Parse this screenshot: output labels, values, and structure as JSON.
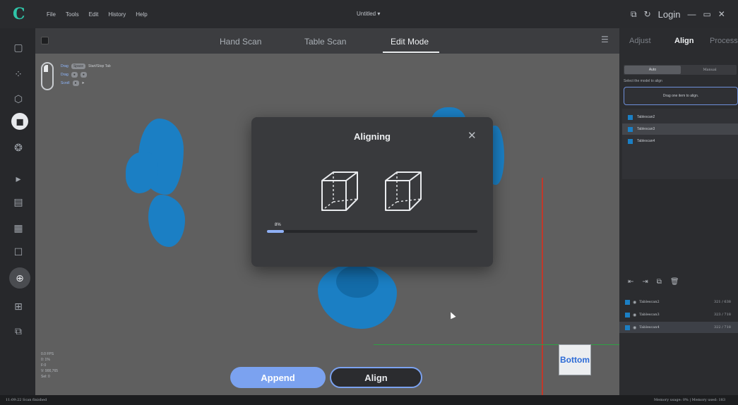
{
  "menu": [
    "File",
    "Tools",
    "Edit",
    "History",
    "Help"
  ],
  "document_title": "Untitled",
  "login_label": "Login",
  "colors": {
    "accent": "#7ba2f0",
    "scan_blue": "#1b7fc4",
    "logo_green": "#2fc4a8"
  },
  "modes": [
    "Hand Scan",
    "Table Scan",
    "Edit Mode"
  ],
  "active_mode": "Edit Mode",
  "mouse_hints": [
    {
      "key": "Drag",
      "chip": "Space",
      "text": "Start/Stop Tab"
    },
    {
      "key": "Drag",
      "chip": "",
      "text": ""
    },
    {
      "key": "Scroll",
      "chip": "",
      "text": ""
    }
  ],
  "viewport": {
    "stats": [
      "0.0 FPS",
      "0: 1%",
      "F:0",
      "V: 900,765",
      "Sel: 0"
    ],
    "viewcube_label": "Bottom"
  },
  "dialog": {
    "title": "Aligning",
    "progress_percent": 8,
    "progress_label": "8%"
  },
  "actions": {
    "append": "Append",
    "align": "Align"
  },
  "right_panel": {
    "tabs": [
      "Adjust",
      "Align",
      "Process"
    ],
    "active_tab": "Align",
    "seg_auto": "Auto",
    "seg_manual": "Manual",
    "instruction": "Select the model to align",
    "drop_hint": "Drag one item to align.",
    "align_items": [
      "Tablescan2",
      "Tablescan3",
      "Tablescan4"
    ],
    "selected_align_item": "Tablescan3",
    "scan_list": [
      {
        "name": "Tablescan2",
        "value": "321 / 638"
      },
      {
        "name": "Tablescan3",
        "value": "323 / 718"
      },
      {
        "name": "Tablescan4",
        "value": "322 / 718"
      }
    ],
    "selected_scan": "Tablescan4"
  },
  "status": {
    "left": "11:09:22 Scan finished",
    "right": "Memory usage: 0% | Memory used: 183"
  }
}
